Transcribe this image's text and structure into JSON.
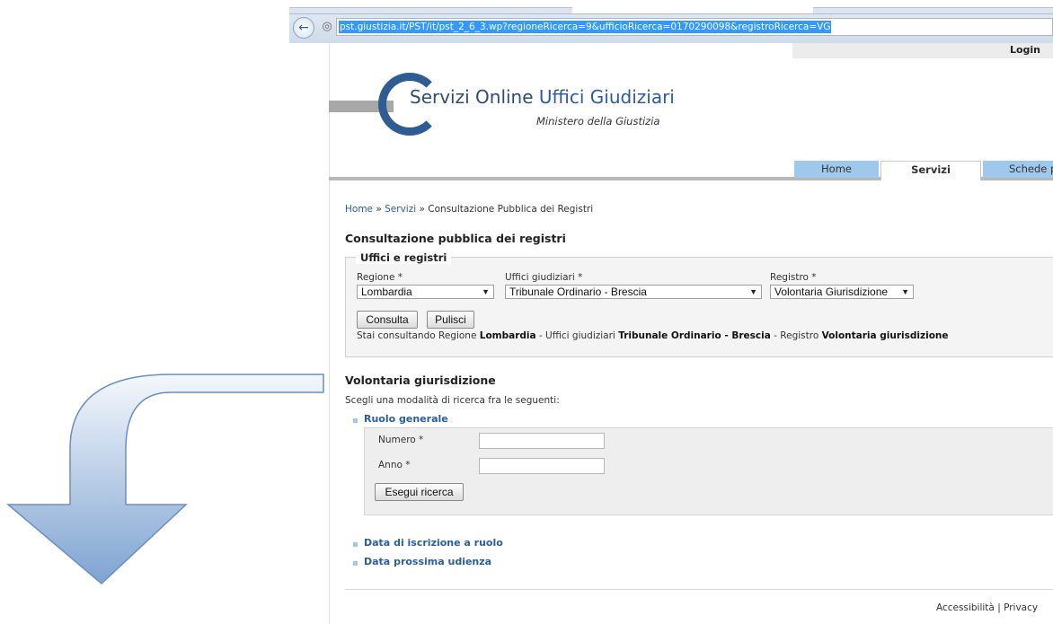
{
  "browser": {
    "url": "pst.giustizia.it/PST/it/pst_2_6_3.wp?regioneRicerca=9&ufficioRicerca=0170290098&registroRicerca=VG"
  },
  "header": {
    "login": "Login",
    "logo_title_prefix": "Servizi Online ",
    "logo_title_highlight": "Uffici Giudiziari",
    "logo_subtitle": "Ministero della Giustizia",
    "tabs": [
      "Home",
      "Servizi",
      "Schede p"
    ]
  },
  "breadcrumb": {
    "home": "Home",
    "sep1": "»",
    "servizi": "Servizi",
    "sep2": "»",
    "current": "Consultazione Pubblica dei Registri"
  },
  "consultazione": {
    "title": "Consultazione pubblica dei registri",
    "legend": "Uffici e registri",
    "regione_label": "Regione *",
    "regione_value": "Lombardia",
    "uffici_label": "Uffici giudiziari *",
    "uffici_value": "Tribunale Ordinario - Brescia",
    "registro_label": "Registro *",
    "registro_value": "Volontaria Giurisdizione",
    "consulta_button": "Consulta",
    "pulisci_button": "Pulisci",
    "status_intro": "Stai consultando Regione",
    "status_regione": "Lombardia",
    "status_sep1": "- Uffici giudiziari",
    "status_ufficio": "Tribunale Ordinario - Brescia",
    "status_sep2": "- Registro",
    "status_registro": "Volontaria giurisdizione"
  },
  "volontaria": {
    "title": "Volontaria giurisdizione",
    "instruction": "Scegli una modalità di ricerca fra le seguenti:",
    "ruolo_generale": "Ruolo generale",
    "numero_label": "Numero *",
    "anno_label": "Anno *",
    "search_button": "Esegui ricerca",
    "data_iscrizione": "Data di iscrizione a ruolo",
    "data_udienza": "Data prossima udienza"
  },
  "footer": {
    "accessibilita": "Accessibilità",
    "sep": "|",
    "privacy": "Privacy"
  },
  "colors": {
    "link": "#2a5d9f",
    "tab_blue": "#9ec8ec",
    "logo_blue": "#2f5c92",
    "url_selection": "#3399ff"
  }
}
